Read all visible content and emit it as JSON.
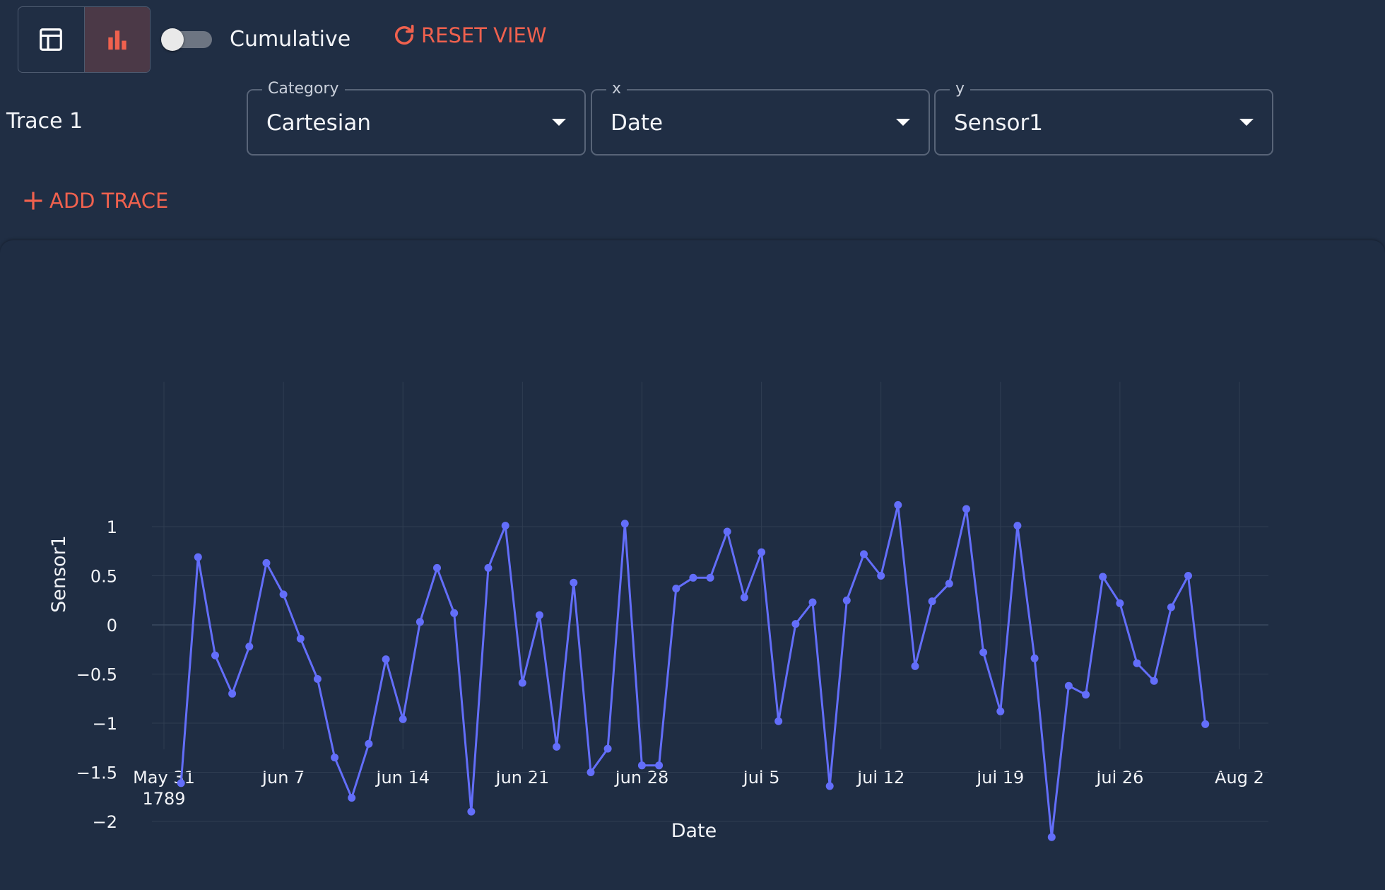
{
  "toolbar": {
    "view_table_icon": "table-icon",
    "view_chart_icon": "bar-chart-icon",
    "active_view": "chart",
    "cumulative_label": "Cumulative",
    "cumulative_on": false,
    "reset_label": "RESET VIEW",
    "reset_icon": "refresh-icon",
    "accent_color": "#f0614e"
  },
  "trace": {
    "label": "Trace 1",
    "category_legend": "Category",
    "category_value": "Cartesian",
    "x_legend": "x",
    "x_value": "Date",
    "y_legend": "y",
    "y_value": "Sensor1"
  },
  "add_trace": {
    "label": "ADD TRACE",
    "icon": "plus-icon"
  },
  "chart_data": {
    "type": "line",
    "mode": "lines+markers",
    "xlabel": "Date",
    "ylabel": "Sensor1",
    "xlim": [
      "1789-05-31",
      "1789-08-02"
    ],
    "ylim": [
      -2.25,
      1.4
    ],
    "grid": true,
    "line_color": "#636efa",
    "x_ticks": [
      {
        "date": "1789-05-31",
        "label": "May 31",
        "sub": "1789"
      },
      {
        "date": "1789-06-07",
        "label": "Jun 7"
      },
      {
        "date": "1789-06-14",
        "label": "Jun 14"
      },
      {
        "date": "1789-06-21",
        "label": "Jun 21"
      },
      {
        "date": "1789-06-28",
        "label": "Jun 28"
      },
      {
        "date": "1789-07-05",
        "label": "Jul 5"
      },
      {
        "date": "1789-07-12",
        "label": "Jul 12"
      },
      {
        "date": "1789-07-19",
        "label": "Jul 19"
      },
      {
        "date": "1789-07-26",
        "label": "Jul 26"
      },
      {
        "date": "1789-08-02",
        "label": "Aug 2"
      }
    ],
    "y_ticks": [
      {
        "value": 1,
        "label": "1"
      },
      {
        "value": 0.5,
        "label": "0.5"
      },
      {
        "value": 0,
        "label": "0"
      },
      {
        "value": -0.5,
        "label": "−0.5"
      },
      {
        "value": -1,
        "label": "−1"
      },
      {
        "value": -1.5,
        "label": "−1.5"
      },
      {
        "value": -2,
        "label": "−2"
      }
    ],
    "series": [
      {
        "x": [
          "1789-06-01",
          "1789-06-02",
          "1789-06-03",
          "1789-06-04",
          "1789-06-05",
          "1789-06-06",
          "1789-06-07",
          "1789-06-08",
          "1789-06-09",
          "1789-06-10",
          "1789-06-11",
          "1789-06-12",
          "1789-06-13",
          "1789-06-14",
          "1789-06-15",
          "1789-06-16",
          "1789-06-17",
          "1789-06-18",
          "1789-06-19",
          "1789-06-20",
          "1789-06-21",
          "1789-06-22",
          "1789-06-23",
          "1789-06-24",
          "1789-06-25",
          "1789-06-26",
          "1789-06-27",
          "1789-06-28",
          "1789-06-29",
          "1789-06-30",
          "1789-07-01",
          "1789-07-02",
          "1789-07-03",
          "1789-07-04",
          "1789-07-05",
          "1789-07-06",
          "1789-07-07",
          "1789-07-08",
          "1789-07-09",
          "1789-07-10",
          "1789-07-11",
          "1789-07-12",
          "1789-07-13",
          "1789-07-14",
          "1789-07-15",
          "1789-07-16",
          "1789-07-17",
          "1789-07-18",
          "1789-07-19",
          "1789-07-20",
          "1789-07-21",
          "1789-07-22",
          "1789-07-23",
          "1789-07-24",
          "1789-07-25",
          "1789-07-26",
          "1789-07-27",
          "1789-07-28",
          "1789-07-29",
          "1789-07-30",
          "1789-07-31"
        ],
        "y": [
          -1.61,
          0.69,
          -0.31,
          -0.7,
          -0.22,
          0.63,
          0.31,
          -0.14,
          -0.55,
          -1.35,
          -1.76,
          -1.21,
          -0.35,
          -0.96,
          0.03,
          0.58,
          0.12,
          -1.9,
          0.58,
          1.01,
          -0.59,
          0.1,
          -1.24,
          0.43,
          -1.5,
          -1.26,
          1.03,
          -1.43,
          -1.43,
          0.37,
          0.48,
          0.48,
          0.95,
          0.28,
          0.74,
          -0.98,
          0.01,
          0.23,
          -1.64,
          0.25,
          0.72,
          0.5,
          1.22,
          -0.42,
          0.24,
          0.42,
          1.18,
          -0.28,
          -0.88,
          1.01,
          -0.34,
          -2.16,
          -0.62,
          -0.71,
          0.49,
          0.22,
          -0.39,
          -0.57,
          0.18,
          0.5,
          -1.01
        ]
      }
    ]
  }
}
